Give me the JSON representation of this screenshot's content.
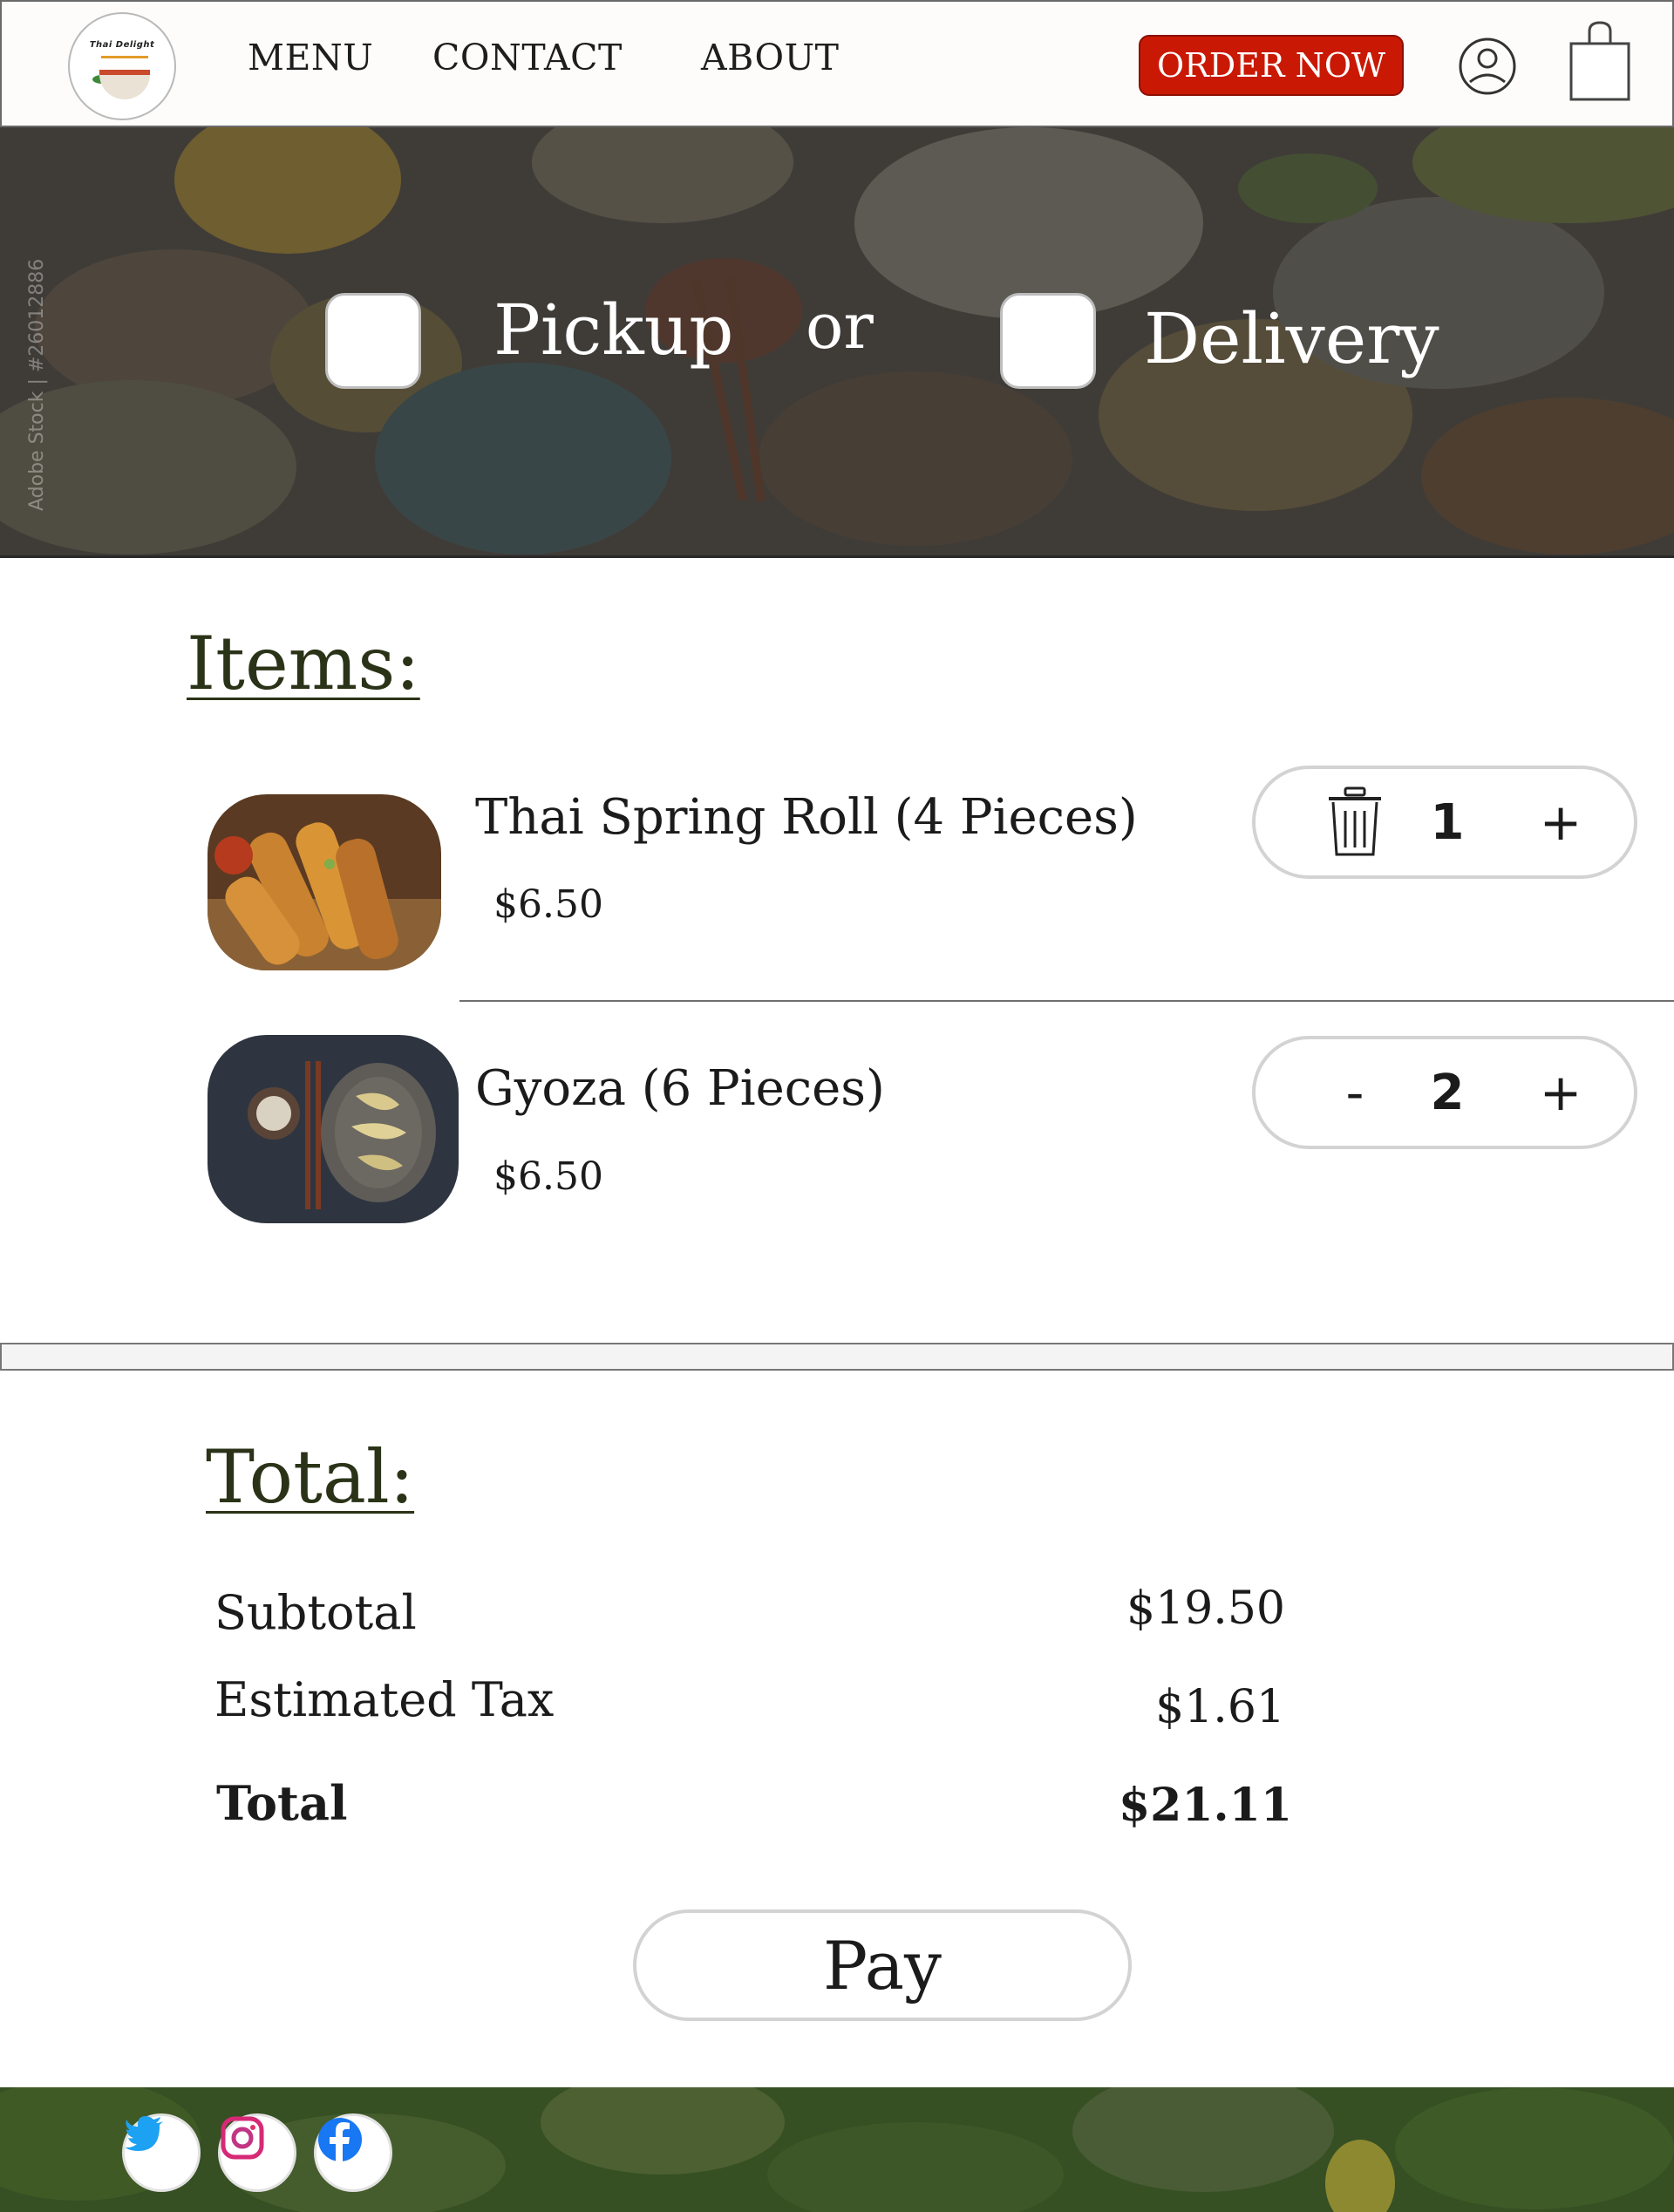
{
  "header": {
    "logo_text": "Thai Delight",
    "nav": [
      "MENU",
      "CONTACT",
      "ABOUT"
    ],
    "order_now": "ORDER NOW",
    "icons": [
      "user-icon",
      "shopping-bag-icon"
    ]
  },
  "hero": {
    "pickup_label": "Pickup",
    "or_label": "or",
    "delivery_label": "Delivery",
    "watermark": "Adobe Stock | #26012886",
    "pickup_checked": false,
    "delivery_checked": false
  },
  "items": {
    "title": "Items:",
    "list": [
      {
        "name": "Thai Spring Roll (4 Pieces)",
        "price": "$6.50",
        "quantity": "1",
        "decrement": "trash-icon",
        "increment": "+"
      },
      {
        "name": "Gyoza (6 Pieces)",
        "price": "$6.50",
        "quantity": "2",
        "decrement": "-",
        "increment": "+"
      }
    ]
  },
  "totals": {
    "title": "Total:",
    "subtotal_label": "Subtotal",
    "subtotal_value": "$19.50",
    "tax_label": "Estimated Tax",
    "tax_value": "$1.61",
    "total_label": "Total",
    "total_value": "$21.11"
  },
  "pay": {
    "label": "Pay"
  },
  "footer": {
    "social": [
      "twitter-icon",
      "instagram-icon",
      "facebook-icon"
    ]
  },
  "colors": {
    "accent_red": "#c91905",
    "title_green": "#2a3317",
    "border_gray": "#d3d3d3",
    "twitter_blue": "#1da1f2",
    "facebook_blue": "#1877f2",
    "instagram_pink": "#d62976"
  }
}
